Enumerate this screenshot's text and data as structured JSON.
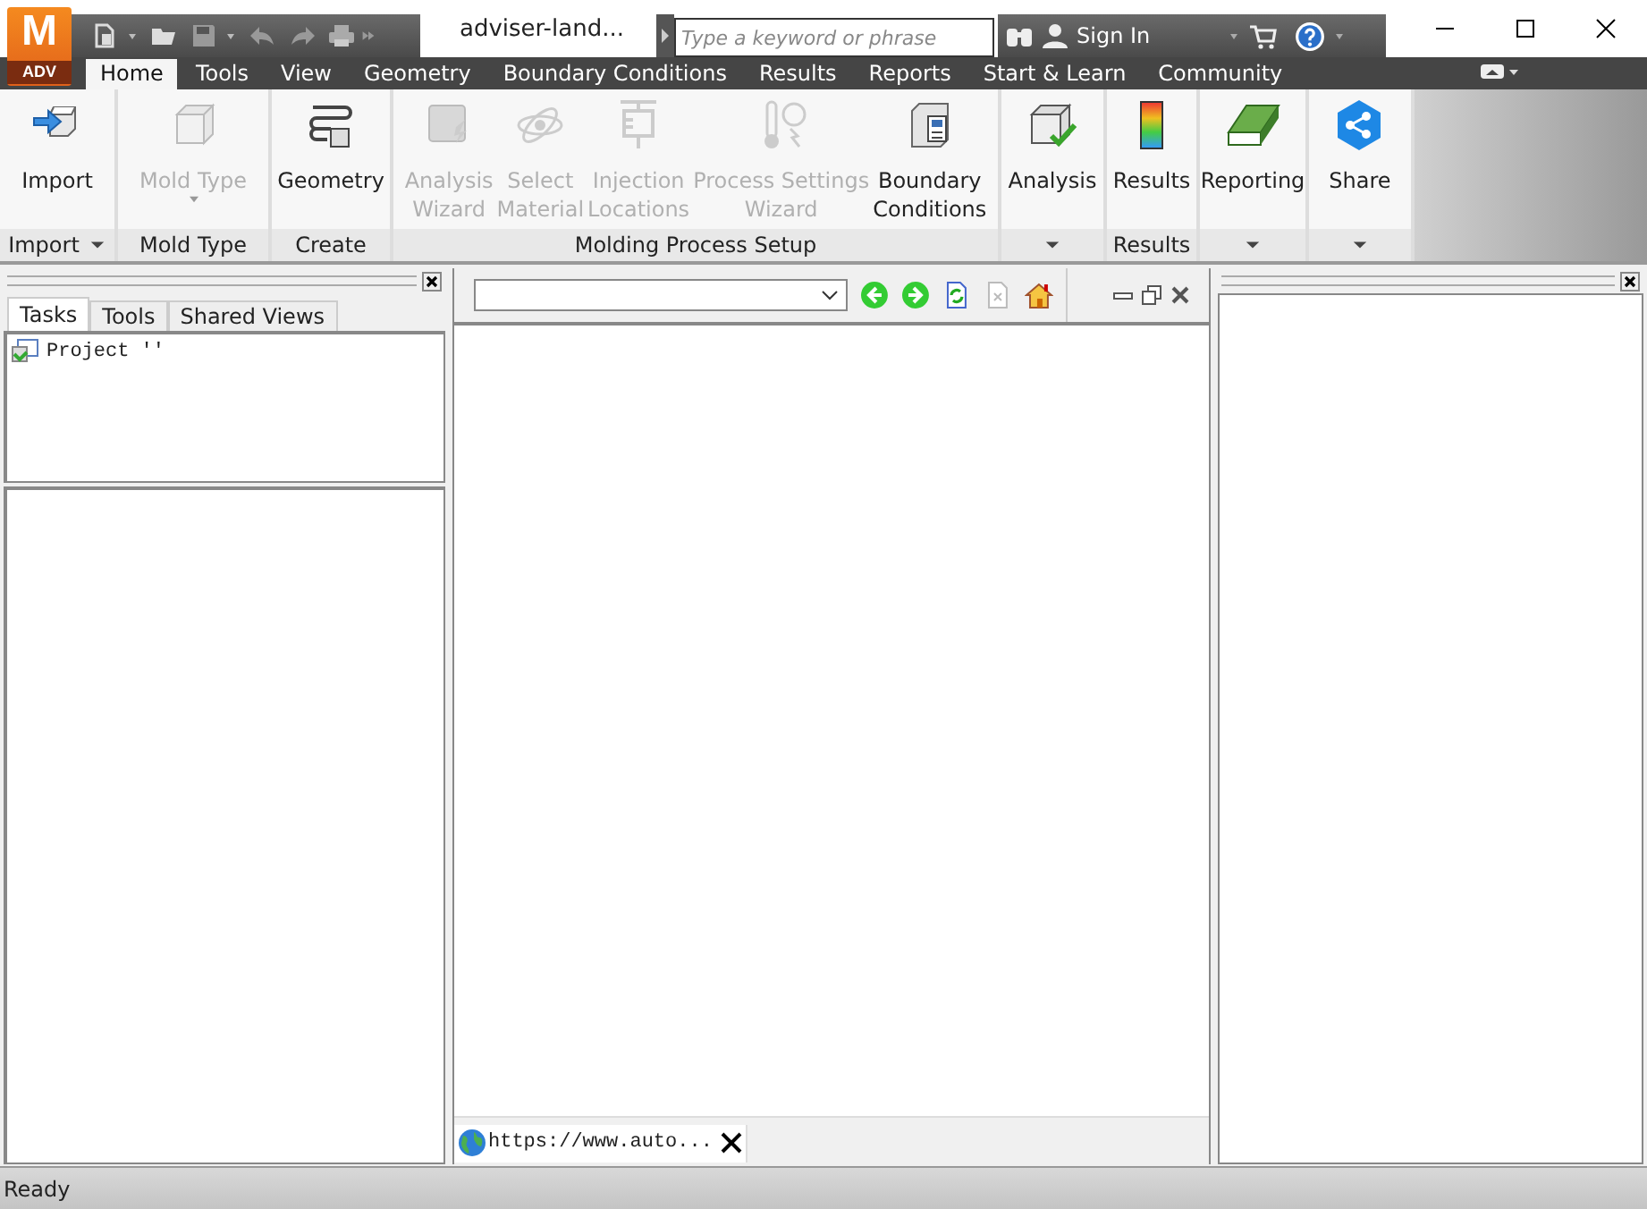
{
  "app_logo": {
    "letter": "M",
    "edition": "ADV"
  },
  "window": {
    "title": "adviser-land..."
  },
  "search": {
    "placeholder": "Type a keyword or phrase"
  },
  "account": {
    "label": "Sign In"
  },
  "ribbon_tabs": [
    {
      "label": "Home",
      "selected": true
    },
    {
      "label": "Tools",
      "selected": false
    },
    {
      "label": "View",
      "selected": false
    },
    {
      "label": "Geometry",
      "selected": false
    },
    {
      "label": "Boundary Conditions",
      "selected": false
    },
    {
      "label": "Results",
      "selected": false
    },
    {
      "label": "Reports",
      "selected": false
    },
    {
      "label": "Start & Learn",
      "selected": false
    },
    {
      "label": "Community",
      "selected": false
    }
  ],
  "ribbon_groups": [
    {
      "label": "Import",
      "menu": true,
      "buttons": [
        {
          "lines": [
            "Import"
          ],
          "disabled": false,
          "dropdown": false
        }
      ]
    },
    {
      "label": "Mold Type",
      "menu": false,
      "buttons": [
        {
          "lines": [
            "Mold Type"
          ],
          "disabled": true,
          "dropdown": true
        }
      ]
    },
    {
      "label": "Create",
      "menu": false,
      "buttons": [
        {
          "lines": [
            "Geometry"
          ],
          "disabled": false,
          "dropdown": false
        }
      ]
    },
    {
      "label": "Molding Process Setup",
      "menu": false,
      "buttons": [
        {
          "lines": [
            "Analysis",
            "Wizard"
          ],
          "disabled": true,
          "dropdown": false
        },
        {
          "lines": [
            "Select",
            "Material"
          ],
          "disabled": true,
          "dropdown": false
        },
        {
          "lines": [
            "Injection",
            "Locations"
          ],
          "disabled": true,
          "dropdown": false
        },
        {
          "lines": [
            "Process Settings",
            "Wizard"
          ],
          "disabled": true,
          "dropdown": false
        },
        {
          "lines": [
            "Boundary",
            "Conditions"
          ],
          "disabled": false,
          "dropdown": false
        }
      ]
    },
    {
      "menu": true,
      "buttons": [
        {
          "lines": [
            "Analysis"
          ],
          "disabled": false,
          "dropdown": false
        }
      ]
    },
    {
      "label": "Results",
      "menu": false,
      "buttons": [
        {
          "lines": [
            "Results"
          ],
          "disabled": false,
          "dropdown": false
        }
      ]
    },
    {
      "menu": true,
      "buttons": [
        {
          "lines": [
            "Reporting"
          ],
          "disabled": false,
          "dropdown": false
        }
      ]
    },
    {
      "menu": true,
      "buttons": [
        {
          "lines": [
            "Share"
          ],
          "disabled": false,
          "dropdown": false
        }
      ]
    }
  ],
  "left_panel": {
    "tabs": [
      {
        "label": "Tasks",
        "selected": true
      },
      {
        "label": "Tools",
        "selected": false
      },
      {
        "label": "Shared Views",
        "selected": false
      }
    ],
    "tree": [
      {
        "label": "Project ''"
      }
    ]
  },
  "browser": {
    "tab": {
      "label": "https://www.auto..."
    }
  },
  "status_bar": {
    "text": "Ready"
  }
}
